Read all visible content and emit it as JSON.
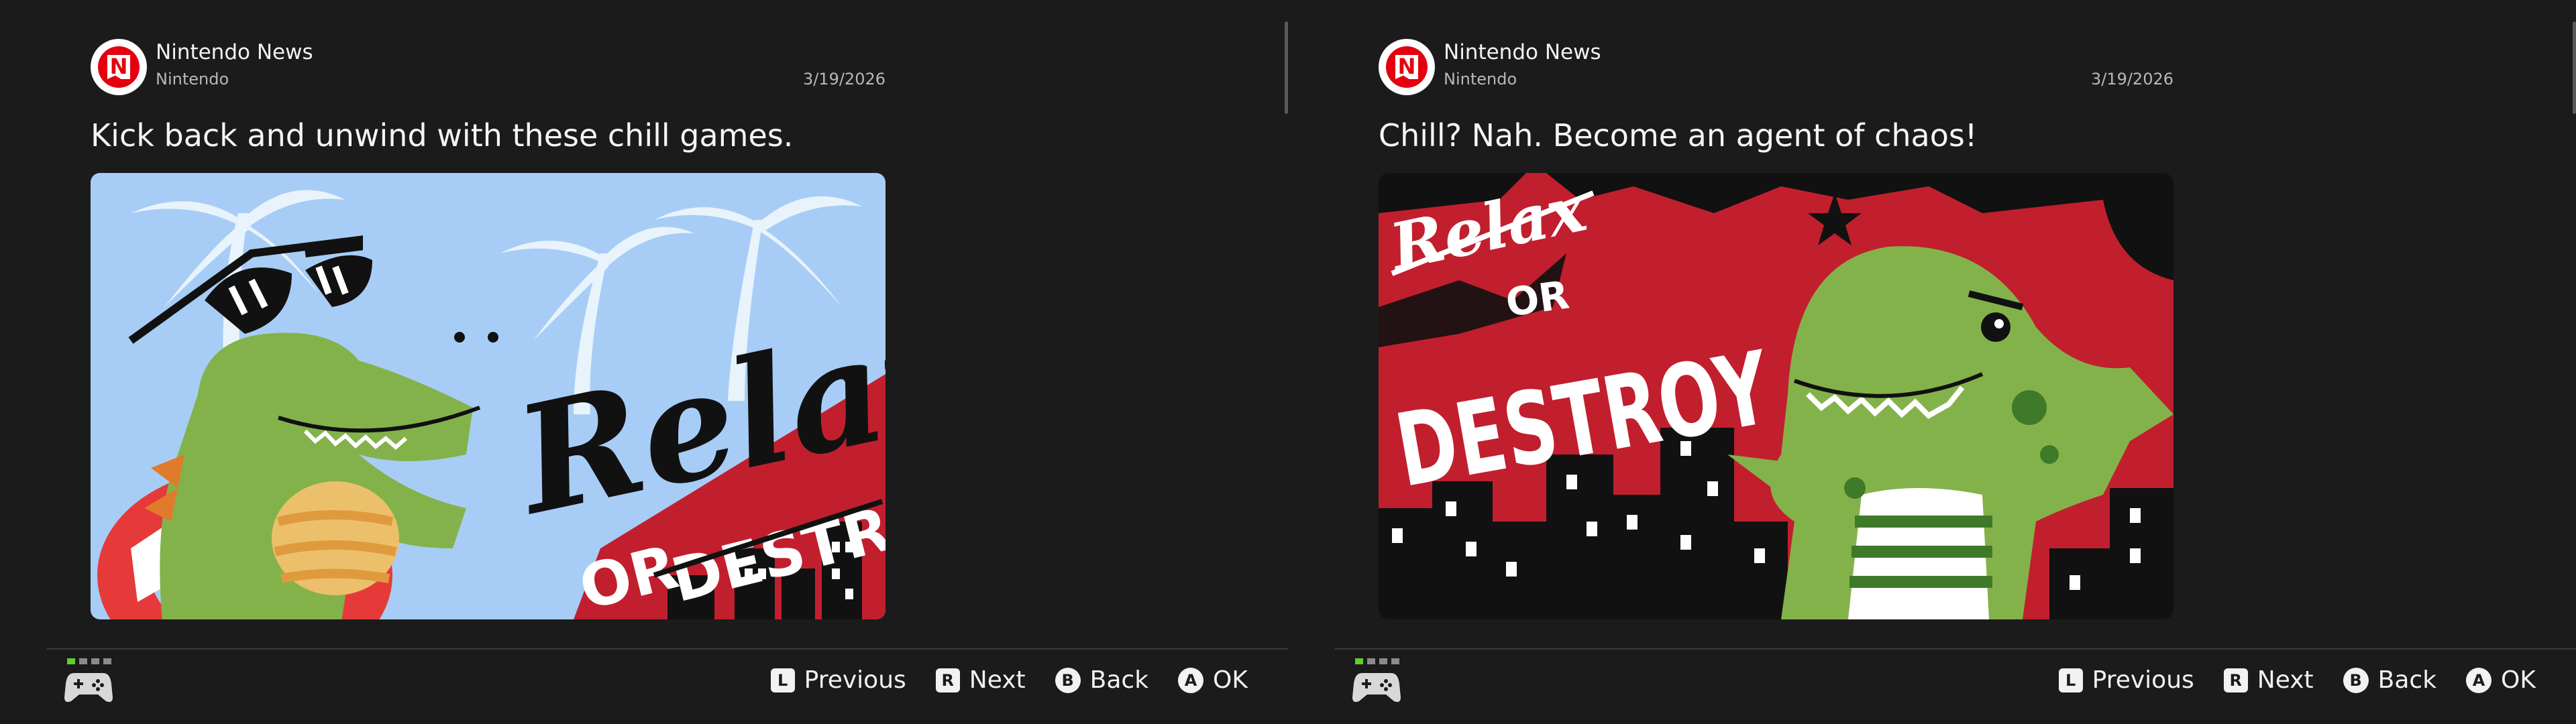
{
  "panels": [
    {
      "channel": "Nintendo News",
      "publisher": "Nintendo",
      "date": "3/19/2026",
      "headline": "Kick back and unwind with these chill games.",
      "image": {
        "title_word": "Relax",
        "or_text": "OR",
        "destroy_text": "DESTROY",
        "palette": {
          "sky": "#a7cdf6",
          "red": "#c11f2e",
          "dino": "#84b24a"
        }
      }
    },
    {
      "channel": "Nintendo News",
      "publisher": "Nintendo",
      "date": "3/19/2026",
      "headline": "Chill? Nah. Become an agent of chaos!",
      "image": {
        "title_word": "Relax",
        "or_text": "OR",
        "destroy_text": "DESTROY",
        "palette": {
          "red": "#c11f2e",
          "black": "#111111",
          "dino": "#84b24a"
        }
      }
    }
  ],
  "footer": {
    "hints": [
      {
        "key": "L",
        "label": "Previous"
      },
      {
        "key": "R",
        "label": "Next"
      },
      {
        "key": "B",
        "label": "Back"
      },
      {
        "key": "A",
        "label": "OK"
      }
    ],
    "controller_icon": "controller-icon"
  },
  "avatar_letter": "N"
}
